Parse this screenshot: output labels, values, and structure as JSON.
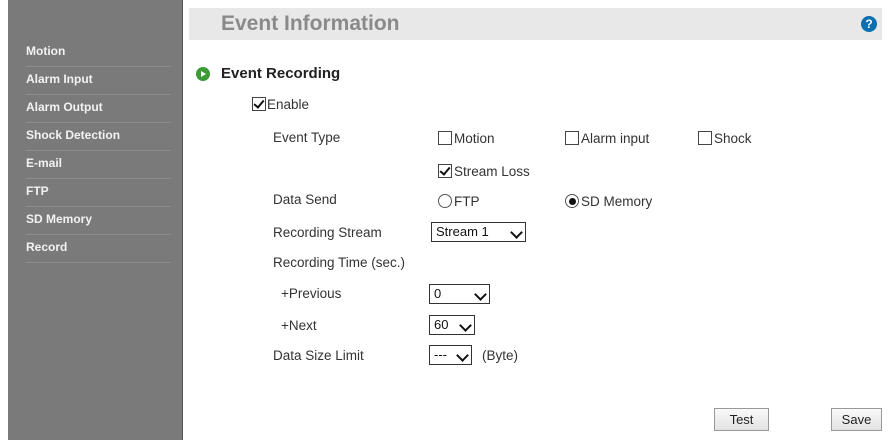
{
  "sidebar": {
    "items": [
      {
        "label": "Motion"
      },
      {
        "label": "Alarm Input"
      },
      {
        "label": "Alarm Output"
      },
      {
        "label": "Shock Detection"
      },
      {
        "label": "E-mail"
      },
      {
        "label": "FTP"
      },
      {
        "label": "SD Memory"
      },
      {
        "label": "Record"
      }
    ]
  },
  "header": {
    "title": "Event Information",
    "help_glyph": "?"
  },
  "section": {
    "title": "Event Recording"
  },
  "form": {
    "enable_label": "Enable",
    "enable_checked": true,
    "event_type": {
      "label": "Event Type",
      "motion": {
        "label": "Motion",
        "checked": false
      },
      "alarm_input": {
        "label": "Alarm input",
        "checked": false
      },
      "shock": {
        "label": "Shock",
        "checked": false
      },
      "stream_loss": {
        "label": "Stream Loss",
        "checked": true
      }
    },
    "data_send": {
      "label": "Data Send",
      "ftp": {
        "label": "FTP",
        "selected": false
      },
      "sd_memory": {
        "label": "SD Memory",
        "selected": true
      }
    },
    "recording_stream": {
      "label": "Recording Stream",
      "value": "Stream 1"
    },
    "recording_time": {
      "label": "Recording Time (sec.)"
    },
    "previous": {
      "label": "+Previous",
      "value": "0"
    },
    "next": {
      "label": "+Next",
      "value": "60"
    },
    "data_size_limit": {
      "label": "Data Size Limit",
      "value": "---",
      "unit": "(Byte)"
    }
  },
  "buttons": {
    "test": "Test",
    "save": "Save"
  },
  "colors": {
    "sidebar_bg": "#7a7a7a",
    "header_bg": "#e8e8e8",
    "accent_green": "#3d9b35",
    "help_blue": "#0a6fb0"
  }
}
